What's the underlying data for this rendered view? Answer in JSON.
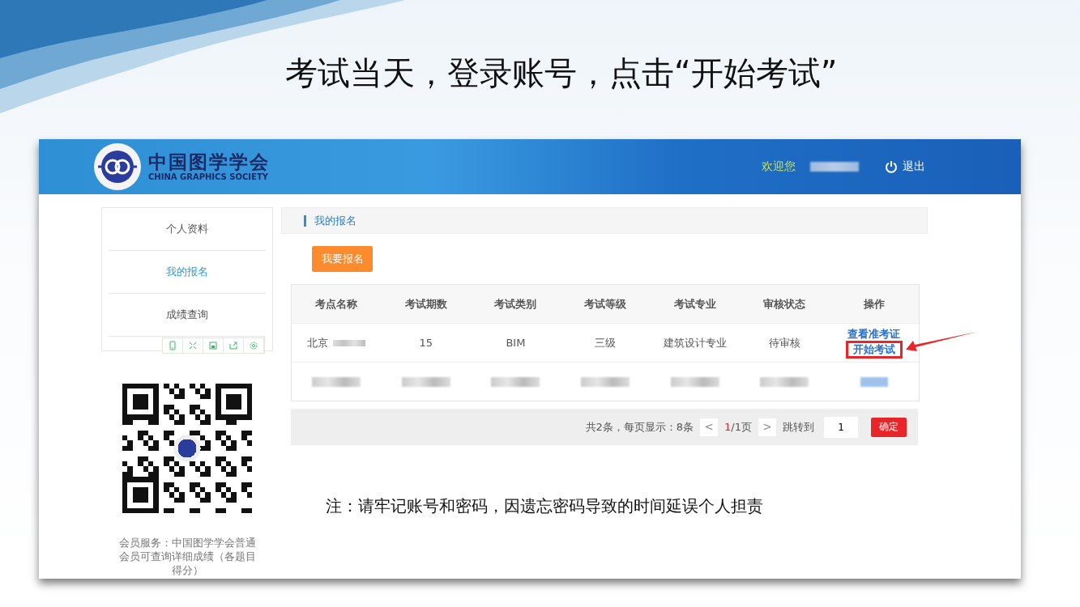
{
  "slide_title": "考试当天，登录账号，点击“开始考试”",
  "header": {
    "logo_cn": "中国图学学会",
    "logo_en": "CHINA GRAPHICS SOCIETY",
    "welcome": "欢迎您",
    "logout": "退出"
  },
  "sidebar": {
    "items": [
      {
        "label": "个人资料",
        "selected": false
      },
      {
        "label": "我的报名",
        "selected": true
      },
      {
        "label": "成绩查询",
        "selected": false
      }
    ],
    "member_note": "会员服务：中国图学学会普通会员可查询详细成绩（各题目得分）"
  },
  "section_title": "我的报名",
  "register_button": "我要报名",
  "table": {
    "columns": [
      "考点名称",
      "考试期数",
      "考试类别",
      "考试等级",
      "考试专业",
      "审核状态",
      "操作"
    ],
    "rows": [
      {
        "kind": "data",
        "cells": [
          {
            "text": "北京",
            "redacted": true
          },
          {
            "text": "15",
            "redacted": false
          },
          {
            "text": "BIM",
            "redacted": false
          },
          {
            "text": "三级",
            "redacted": false
          },
          {
            "text": "建筑设计专业",
            "redacted": false
          },
          {
            "text": "待审核",
            "redacted": false
          }
        ],
        "actions": [
          "查看准考证",
          "开始考试"
        ]
      },
      {
        "kind": "redacted"
      }
    ]
  },
  "pagination": {
    "summary": "共2条，每页显示：8条",
    "prev": "<",
    "current": "1",
    "total": "/1页",
    "next": ">",
    "jump_label": "跳转到",
    "jump_value": "1",
    "confirm": "确定"
  },
  "note": "注：请牢记账号和密码，因遗忘密码导致的时间延误个人担责"
}
